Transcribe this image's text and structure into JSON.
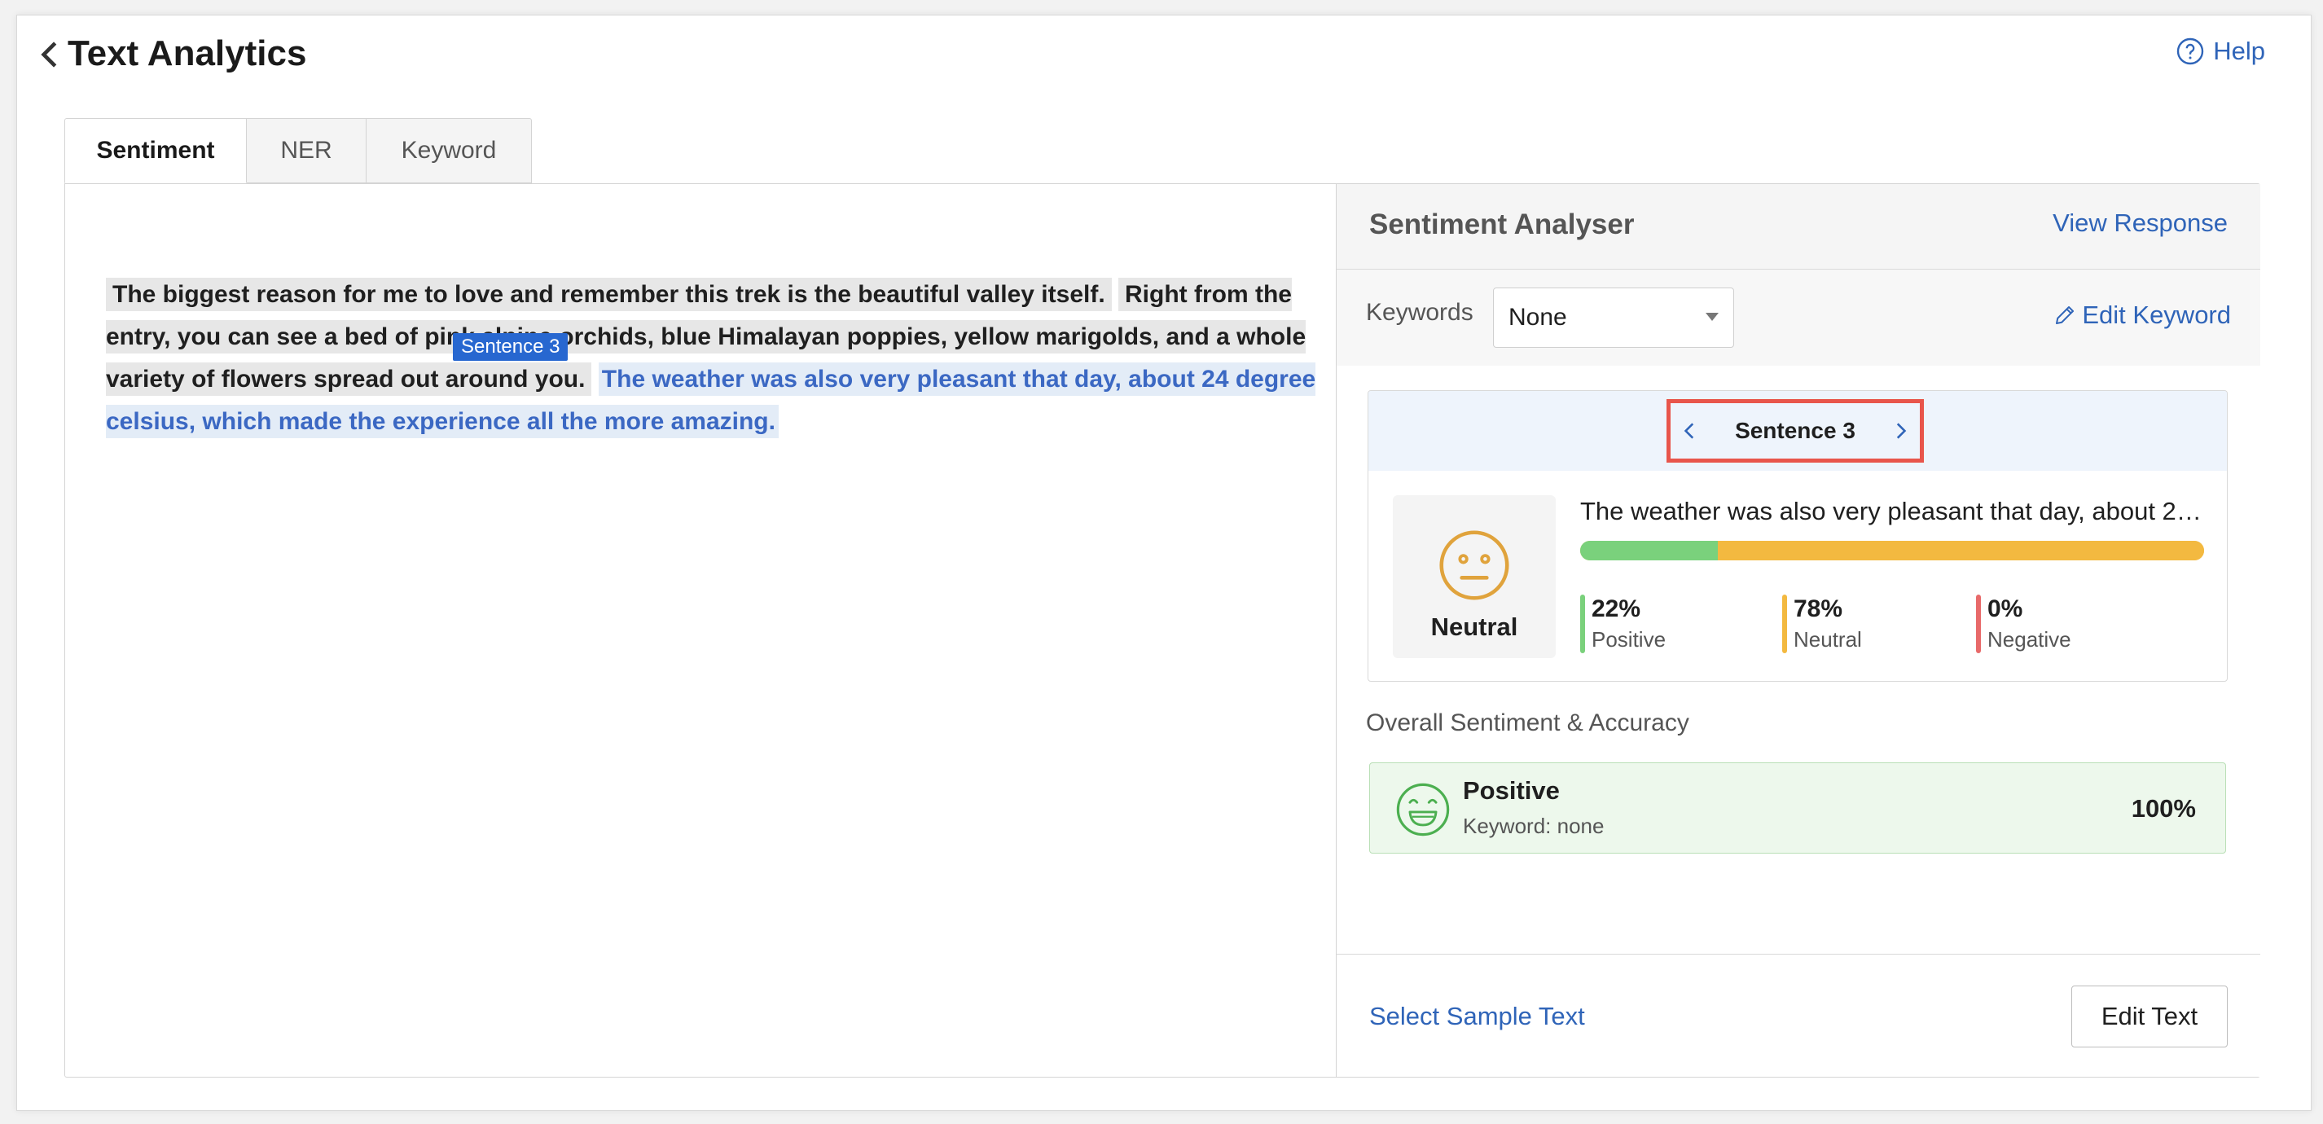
{
  "header": {
    "title": "Text Analytics",
    "help_label": "Help"
  },
  "tabs": [
    {
      "label": "Sentiment",
      "active": true
    },
    {
      "label": "NER",
      "active": false
    },
    {
      "label": "Keyword",
      "active": false
    }
  ],
  "input_text": {
    "sentence_1": "The biggest reason for me to love and remember this trek is the beautiful valley itself.",
    "sentence_2": "Right from the entry, you can see a bed of pink alpine orchids, blue Himalayan poppies, yellow marigolds, and a whole variety of flowers spread out around you.",
    "sentence_3": "The weather was also very pleasant that day, about 24 degree celsius, which made the experience all the more amazing.",
    "selected_tag": "Sentence 3"
  },
  "analyser": {
    "title": "Sentiment Analyser",
    "view_response": "View Response",
    "keywords_label": "Keywords",
    "keywords_value": "None",
    "edit_keyword": "Edit Keyword",
    "sentence_nav_label": "Sentence 3",
    "sentence_mood": "Neutral",
    "sentence_preview": "The weather was also very pleasant that day, about 24 de...",
    "scores": [
      {
        "pct": "22%",
        "label": "Positive",
        "value": 22,
        "color": "#7ad17c"
      },
      {
        "pct": "78%",
        "label": "Neutral",
        "value": 78,
        "color": "#f3b940"
      },
      {
        "pct": "0%",
        "label": "Negative",
        "value": 0,
        "color": "#e86a6a"
      }
    ],
    "overall_title": "Overall Sentiment & Accuracy",
    "overall_sentiment": "Positive",
    "overall_keyword": "Keyword: none",
    "overall_accuracy": "100%",
    "select_sample": "Select Sample Text",
    "edit_text": "Edit Text"
  },
  "colors": {
    "accent": "#2f64b8",
    "highlight_box": "#e8554b",
    "positive_face": "#4caf50",
    "neutral_face": "#e0a33c"
  }
}
